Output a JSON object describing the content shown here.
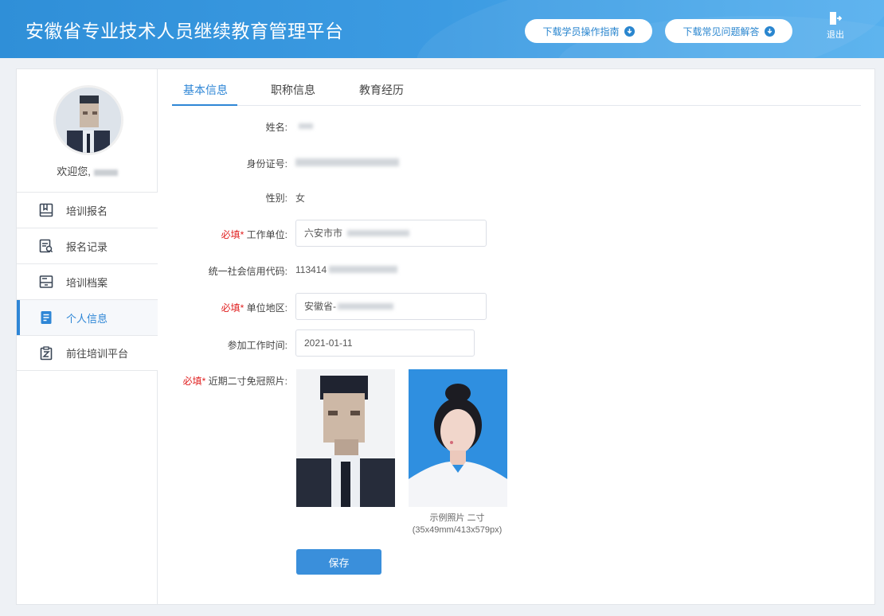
{
  "header": {
    "title": "安徽省专业技术人员继续教育管理平台",
    "guide_label": "下载学员操作指南",
    "faq_label": "下载常见问题解答",
    "logout_label": "退出"
  },
  "sidebar": {
    "welcome": "欢迎您,",
    "items": [
      {
        "label": "培训报名",
        "icon": "book-icon"
      },
      {
        "label": "报名记录",
        "icon": "record-search-icon"
      },
      {
        "label": "培训档案",
        "icon": "archive-icon"
      },
      {
        "label": "个人信息",
        "icon": "document-icon",
        "active": true
      },
      {
        "label": "前往培训平台",
        "icon": "clipboard-icon"
      }
    ]
  },
  "tabs": [
    "基本信息",
    "职称信息",
    "教育经历"
  ],
  "form": {
    "required_mark": "必填*",
    "name_label": "姓名:",
    "id_label": "身份证号:",
    "gender_label": "性别:",
    "gender_value": "女",
    "work_unit_label": "工作单位:",
    "work_unit_value": "六安市市",
    "credit_code_label": "统一社会信用代码:",
    "credit_code_value": "113414",
    "region_label": "单位地区:",
    "region_value": "安徽省-",
    "work_date_label": "参加工作时间:",
    "work_date_value": "2021-01-11",
    "photo_label": "近期二寸免冠照片:",
    "sample_caption_1": "示例照片 二寸",
    "sample_caption_2": "(35x49mm/413x579px)",
    "save_label": "保存"
  },
  "colors": {
    "header_blue": "#3c9be2",
    "accent": "#2e86d6",
    "required": "#e02020",
    "sample_photo_bg": "#2f8fe0"
  }
}
